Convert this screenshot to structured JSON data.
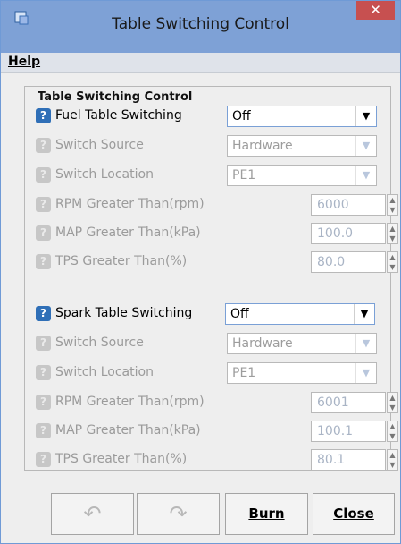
{
  "window": {
    "title": "Table Switching Control",
    "close_glyph": "✕"
  },
  "menu": {
    "help": "Help"
  },
  "group": {
    "title": "Table Switching Control"
  },
  "fuel": {
    "label": "Fuel Table Switching",
    "value": "Off",
    "switch_source_label": "Switch Source",
    "switch_source_value": "Hardware",
    "switch_location_label": "Switch Location",
    "switch_location_value": "PE1",
    "rpm_label": "RPM Greater Than(rpm)",
    "rpm_value": "6000",
    "map_label": "MAP Greater Than(kPa)",
    "map_value": "100.0",
    "tps_label": "TPS Greater Than(%)",
    "tps_value": "80.0"
  },
  "spark": {
    "label": "Spark Table Switching",
    "value": "Off",
    "switch_source_label": "Switch Source",
    "switch_source_value": "Hardware",
    "switch_location_label": "Switch Location",
    "switch_location_value": "PE1",
    "rpm_label": "RPM Greater Than(rpm)",
    "rpm_value": "6001",
    "map_label": "MAP Greater Than(kPa)",
    "map_value": "100.1",
    "tps_label": "TPS Greater Than(%)",
    "tps_value": "80.1"
  },
  "buttons": {
    "burn": "Burn",
    "close": "Close"
  },
  "icons": {
    "help_active": "?",
    "help_disabled": "?",
    "dropdown": "▼",
    "spin_up": "▲",
    "spin_down": "▼",
    "undo": "↶",
    "redo": "↷"
  },
  "colors": {
    "titlebar": "#7ea1d6",
    "close_button": "#c75050",
    "help_icon_active": "#2f6fb7"
  }
}
